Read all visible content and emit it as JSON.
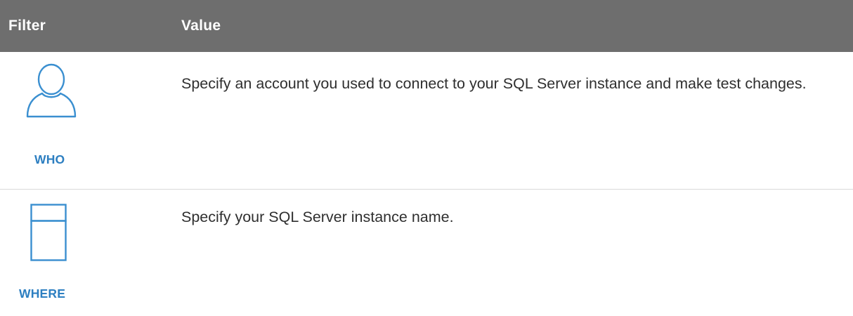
{
  "header": {
    "filter_label": "Filter",
    "value_label": "Value",
    "background_color": "#6e6e6e"
  },
  "rows": [
    {
      "icon": "person-icon",
      "label": "WHO",
      "value": "Specify an account you used to connect to your SQL Server instance and make test changes."
    },
    {
      "icon": "server-icon",
      "label": "WHERE",
      "value": "Specify your SQL Server instance name."
    }
  ],
  "colors": {
    "accent": "#2d7fc1",
    "divider": "#d9d9d9"
  }
}
